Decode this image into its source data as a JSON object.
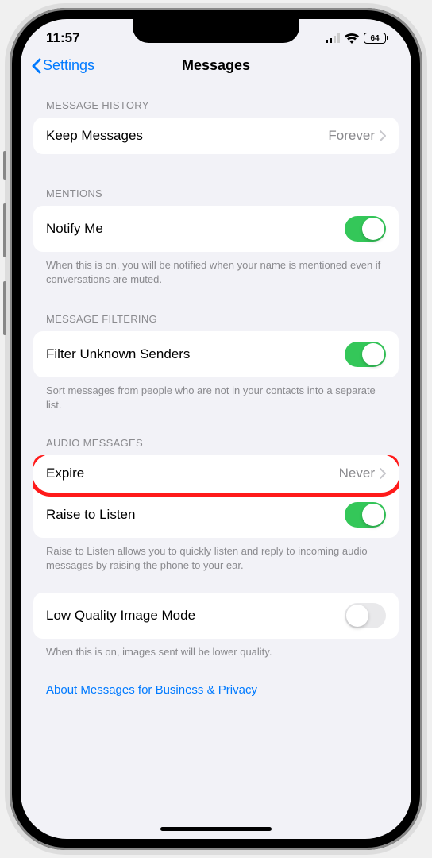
{
  "status": {
    "time": "11:57",
    "battery": "64"
  },
  "nav": {
    "back": "Settings",
    "title": "Messages"
  },
  "sections": {
    "messageHistory": {
      "header": "MESSAGE HISTORY",
      "keepMessages": {
        "label": "Keep Messages",
        "value": "Forever"
      }
    },
    "mentions": {
      "header": "MENTIONS",
      "notifyMe": {
        "label": "Notify Me",
        "on": true
      },
      "footer": "When this is on, you will be notified when your name is mentioned even if conversations are muted."
    },
    "messageFiltering": {
      "header": "MESSAGE FILTERING",
      "filterUnknown": {
        "label": "Filter Unknown Senders",
        "on": true
      },
      "footer": "Sort messages from people who are not in your contacts into a separate list."
    },
    "audioMessages": {
      "header": "AUDIO MESSAGES",
      "expire": {
        "label": "Expire",
        "value": "Never"
      },
      "raiseToListen": {
        "label": "Raise to Listen",
        "on": true
      },
      "footer": "Raise to Listen allows you to quickly listen and reply to incoming audio messages by raising the phone to your ear."
    },
    "lowQuality": {
      "label": "Low Quality Image Mode",
      "on": false,
      "footer": "When this is on, images sent will be lower quality."
    },
    "aboutLink": "About Messages for Business & Privacy"
  }
}
